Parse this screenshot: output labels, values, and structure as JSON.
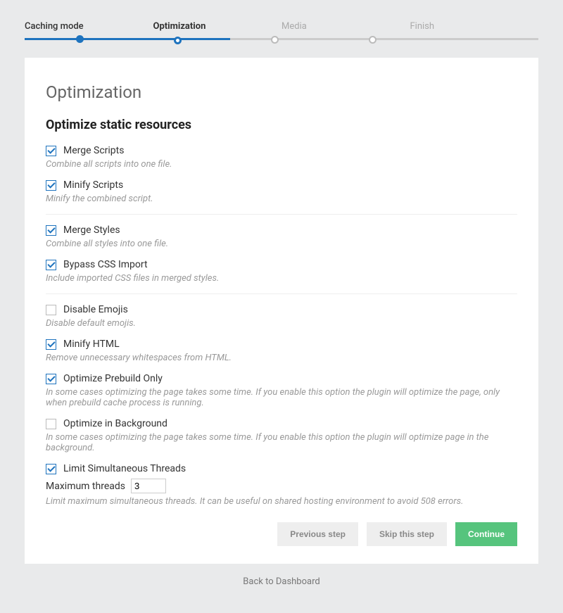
{
  "stepper": {
    "steps": [
      {
        "label": "Caching mode",
        "state": "done"
      },
      {
        "label": "Optimization",
        "state": "active"
      },
      {
        "label": "Media",
        "state": "pending"
      },
      {
        "label": "Finish",
        "state": "pending"
      }
    ]
  },
  "page": {
    "title": "Optimization",
    "section_title": "Optimize static resources"
  },
  "options": {
    "merge_scripts": {
      "label": "Merge Scripts",
      "desc": "Combine all scripts into one file.",
      "checked": true
    },
    "minify_scripts": {
      "label": "Minify Scripts",
      "desc": "Minify the combined script.",
      "checked": true
    },
    "merge_styles": {
      "label": "Merge Styles",
      "desc": "Combine all styles into one file.",
      "checked": true
    },
    "bypass_css_import": {
      "label": "Bypass CSS Import",
      "desc": "Include imported CSS files in merged styles.",
      "checked": true
    },
    "disable_emojis": {
      "label": "Disable Emojis",
      "desc": "Disable default emojis.",
      "checked": false
    },
    "minify_html": {
      "label": "Minify HTML",
      "desc": "Remove unnecessary whitespaces from HTML.",
      "checked": true
    },
    "optimize_prebuild_only": {
      "label": "Optimize Prebuild Only",
      "desc": "In some cases optimizing the page takes some time. If you enable this option the plugin will optimize the page, only when prebuild cache process is running.",
      "checked": true
    },
    "optimize_in_background": {
      "label": "Optimize in Background",
      "desc": "In some cases optimizing the page takes some time. If you enable this option the plugin will optimize page in the background.",
      "checked": false
    },
    "limit_threads": {
      "label": "Limit Simultaneous Threads",
      "desc": "Limit maximum simultaneous threads. It can be useful on shared hosting environment to avoid 508 errors.",
      "checked": true
    },
    "max_threads_label": "Maximum threads",
    "max_threads_value": "3"
  },
  "actions": {
    "prev": "Previous step",
    "skip": "Skip this step",
    "continue": "Continue"
  },
  "back_link": "Back to Dashboard"
}
